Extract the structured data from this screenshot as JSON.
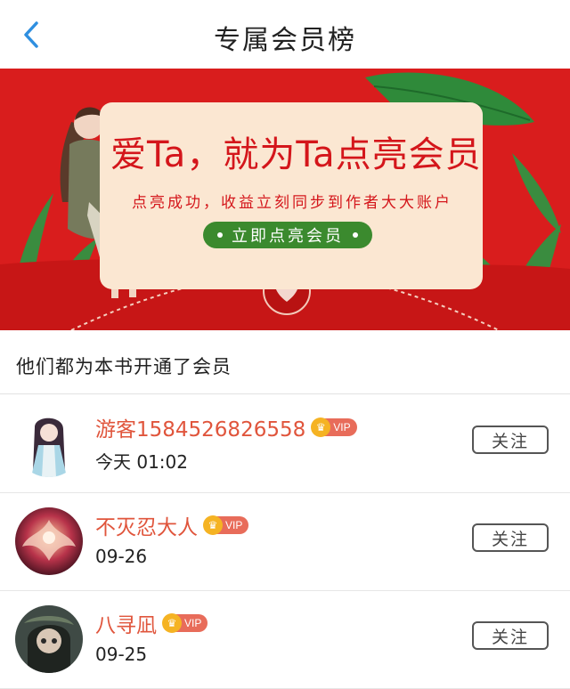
{
  "header": {
    "title": "专属会员榜",
    "back_icon": "chevron-left-icon"
  },
  "banner": {
    "title": "爱Ta，就为Ta点亮会员",
    "subtitle": "点亮成功，收益立刻同步到作者大大账户",
    "cta_label": "立即点亮会员",
    "colors": {
      "background": "#d91d1d",
      "letter": "#fbe7d2",
      "button": "#3b8a2e",
      "text": "#d4161b"
    }
  },
  "section": {
    "title": "他们都为本书开通了会员"
  },
  "members": [
    {
      "name": "游客1584526826558",
      "badge": "VIP",
      "date": "今天 01:02",
      "follow_label": "关注"
    },
    {
      "name": "不灭忍大人",
      "badge": "VIP",
      "date": "09-26",
      "follow_label": "关注"
    },
    {
      "name": "八寻凪",
      "badge": "VIP",
      "date": "09-25",
      "follow_label": "关注"
    }
  ]
}
